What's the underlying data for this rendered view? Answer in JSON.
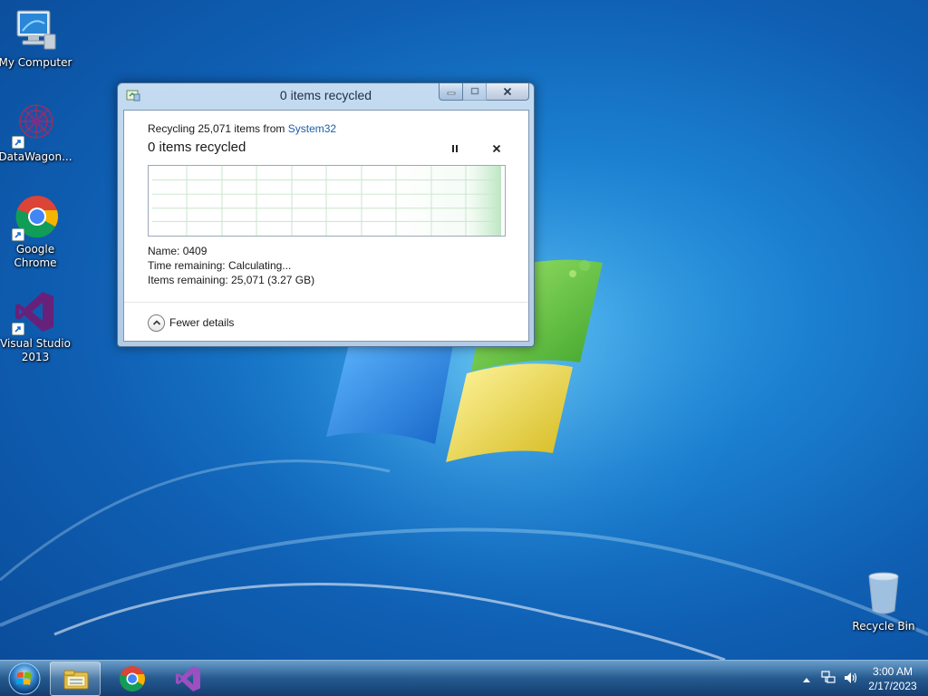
{
  "desktop": {
    "icons": [
      {
        "label": "My Computer",
        "icon": "computer-icon"
      },
      {
        "label": "DataWagon...",
        "icon": "datawagon-icon"
      },
      {
        "label": "Google Chrome",
        "icon": "chrome-icon"
      },
      {
        "label": "Visual Studio 2013",
        "icon": "visual-studio-icon"
      },
      {
        "label": "Recycle Bin",
        "icon": "recycle-bin-icon"
      }
    ]
  },
  "dialog": {
    "title": "0 items recycled",
    "recycling_prefix": "Recycling 25,071 items from ",
    "source_link": "System32",
    "progress_text": "0 items recycled",
    "name_label": "Name:",
    "name_value": "0409",
    "time_label": "Time remaining:",
    "time_value": "Calculating...",
    "items_label": "Items remaining:",
    "items_value": "25,071 (3.27 GB)",
    "toggle_details": "Fewer details",
    "progress_fraction": 0.0
  },
  "taskbar": {
    "pinned": [
      "windows-explorer-icon",
      "chrome-icon",
      "visual-studio-icon"
    ],
    "clock_time": "3:00 AM",
    "clock_date": "2/17/2023"
  },
  "colors": {
    "desktop_blue": "#1b7fd0",
    "link_blue": "#1b5ea8",
    "graph_green": "#7dce8a",
    "vs_purple": "#68217a"
  }
}
